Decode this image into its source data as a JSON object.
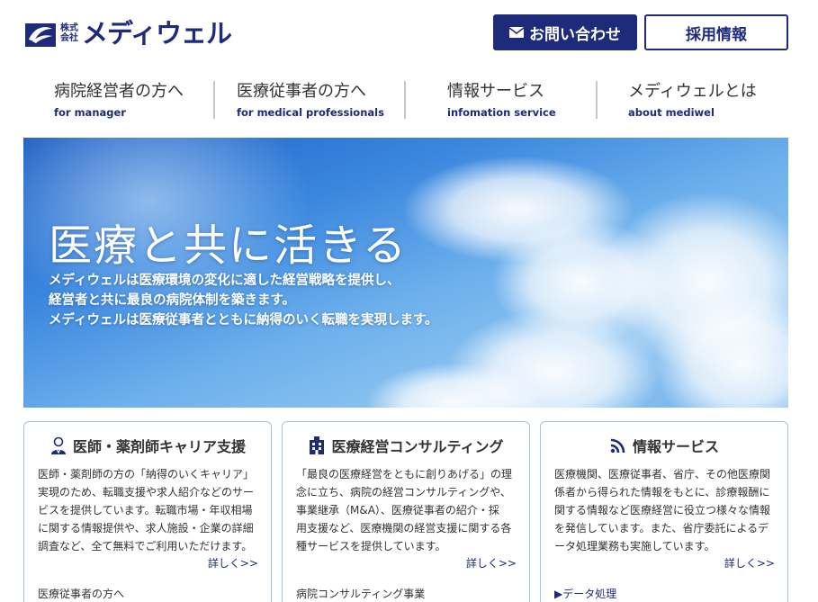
{
  "header": {
    "logo_kabu_top": "株式",
    "logo_kabu_bottom": "会社",
    "logo_name": "メディウェル",
    "contact_label": "お問い合わせ",
    "recruit_label": "採用情報"
  },
  "nav": [
    {
      "jp": "病院経営者の方へ",
      "en": "for manager"
    },
    {
      "jp": "医療従事者の方へ",
      "en": "for medical professionals"
    },
    {
      "jp": "情報サービス",
      "en": "infomation service"
    },
    {
      "jp": "メディウェルとは",
      "en": "about mediwel"
    }
  ],
  "hero": {
    "title": "医療と共に活きる",
    "line1": "メディウェルは医療環境の変化に適した経営戦略を提供し、",
    "line2": "経営者と共に最良の病院体制を築きます。",
    "line3": "メディウェルは医療従事者とともに納得のいく転職を実現します。"
  },
  "cards": [
    {
      "icon": "doctor-icon",
      "title": "医師・薬剤師キャリア支援",
      "lines": [
        "医師・薬剤師の方の「納得のいくキャリア」",
        "実現のため、転職支援や求人紹介などのサー",
        "ビスを提供しています。転職市場・年収相場",
        "に関する情報提供や、求人施設・企業の詳細",
        "調査など、全て無料でご利用いただけます。"
      ],
      "more": "詳しく>>",
      "foot": "医療従事者の方へ"
    },
    {
      "icon": "building-icon",
      "title": "医療経営コンサルティング",
      "lines": [
        "「最良の医療経営をともに創りあげる」の理",
        "念に立ち、病院の経営コンサルティングや、",
        "事業継承（M&A）、医療従事者の紹介・採",
        "用支援など、医療機関の経営支援に関する各",
        "種サービスを提供しています。"
      ],
      "more": "詳しく>>",
      "foot": "病院コンサルティング事業"
    },
    {
      "icon": "signal-icon",
      "title": "情報サービス",
      "lines": [
        "医療機関、医療従事者、省庁、その他医療関",
        "係者から得られた情報をもとに、診療報酬に",
        "関する情報など医療経営に役立つ様々な情報",
        "を発信しています。また、省庁委託によるデ",
        "ータ処理業務も実施しています。"
      ],
      "more": "詳しく>>",
      "foot": "▶データ処理"
    }
  ],
  "colors": {
    "brand": "#1e2a7a",
    "card_border": "#a9c0e0"
  }
}
